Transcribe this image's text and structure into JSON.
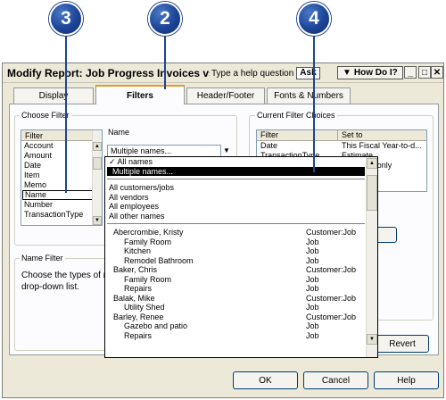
{
  "callouts": [
    "3",
    "2",
    "4"
  ],
  "window": {
    "title": "Modify Report: Job Progress Invoices vs. E",
    "help_question": "Type a help question",
    "ask_label": "Ask",
    "how_do_i_label": "How Do I?",
    "minimize_label": "_",
    "maximize_label": "□",
    "close_label": "✕"
  },
  "tabs": [
    {
      "label": "Display"
    },
    {
      "label": "Filters"
    },
    {
      "label": "Header/Footer"
    },
    {
      "label": "Fonts & Numbers"
    }
  ],
  "choose_filter": {
    "group_label": "Choose Filter",
    "list_header": "Filter",
    "items": [
      "Account",
      "Amount",
      "Date",
      "Item",
      "Memo",
      "Name",
      "Number",
      "TransactionType"
    ],
    "selected": "Name",
    "name_label": "Name",
    "name_value": "Multiple names..."
  },
  "name_filter": {
    "group_label": "Name Filter",
    "text": "Choose the types of n",
    "text2": "drop-down list."
  },
  "current_filters": {
    "group_label": "Current Filter Choices",
    "col_filter": "Filter",
    "col_set_to": "Set to",
    "rows": [
      {
        "filter": "Date",
        "set_to": "This Fiscal Year-to-d..."
      },
      {
        "filter": "TransactionType",
        "set_to": "Estimate"
      }
    ],
    "partial_only": "only"
  },
  "dropdown": {
    "top_items": [
      "✓ All names",
      "Multiple names..."
    ],
    "group_items": [
      "All customers/jobs",
      "All vendors",
      "All employees",
      "All other names"
    ],
    "names": [
      {
        "name": "Abercrombie, Kristy",
        "type": "Customer:Job",
        "sub": false
      },
      {
        "name": "Family Room",
        "type": "Job",
        "sub": true
      },
      {
        "name": "Kitchen",
        "type": "Job",
        "sub": true
      },
      {
        "name": "Remodel Bathroom",
        "type": "Job",
        "sub": true
      },
      {
        "name": "Baker, Chris",
        "type": "Customer:Job",
        "sub": false
      },
      {
        "name": "Family Room",
        "type": "Job",
        "sub": true
      },
      {
        "name": "Repairs",
        "type": "Job",
        "sub": true
      },
      {
        "name": "Balak, Mike",
        "type": "Customer:Job",
        "sub": false
      },
      {
        "name": "Utility Shed",
        "type": "Job",
        "sub": true
      },
      {
        "name": "Barley, Renee",
        "type": "Customer:Job",
        "sub": false
      },
      {
        "name": "Gazebo and patio",
        "type": "Job",
        "sub": true
      },
      {
        "name": "Repairs",
        "type": "Job",
        "sub": true
      }
    ]
  },
  "buttons": {
    "revert": "Revert",
    "ok": "OK",
    "cancel": "Cancel",
    "help": "Help"
  }
}
